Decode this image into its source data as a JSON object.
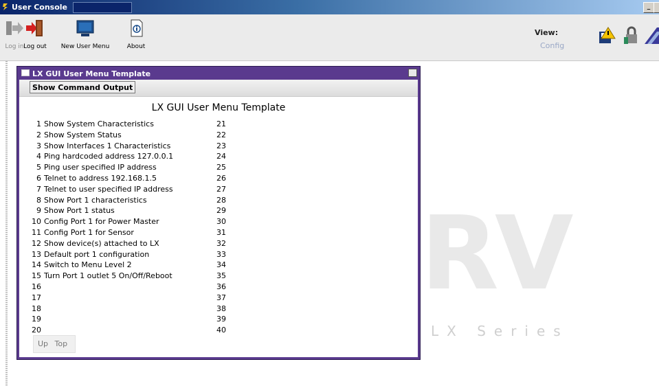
{
  "window": {
    "title": "User Console"
  },
  "toolbar": {
    "items": [
      {
        "label": "Log in",
        "icon": "login-arrow-icon",
        "enabled": false
      },
      {
        "label": "Log out",
        "icon": "logout-door-icon",
        "enabled": true
      },
      {
        "label": "New User Menu",
        "icon": "monitor-menu-icon",
        "enabled": true
      },
      {
        "label": "About",
        "icon": "info-document-icon",
        "enabled": true
      }
    ],
    "view_label": "View:",
    "view_value": "Config"
  },
  "watermark": {
    "brand": "RV",
    "series": "LX Series"
  },
  "inner_window": {
    "title": "LX GUI User Menu Template",
    "command_button": "Show Command Output",
    "heading": "LX GUI User Menu Template",
    "left_column": [
      {
        "num": "1",
        "text": "Show System Characteristics"
      },
      {
        "num": "2",
        "text": "Show System Status"
      },
      {
        "num": "3",
        "text": "Show Interfaces 1 Characteristics"
      },
      {
        "num": "4",
        "text": "Ping hardcoded address 127.0.0.1"
      },
      {
        "num": "5",
        "text": "Ping user specified IP address"
      },
      {
        "num": "6",
        "text": "Telnet to address 192.168.1.5"
      },
      {
        "num": "7",
        "text": "Telnet to user specified IP address"
      },
      {
        "num": "8",
        "text": "Show Port 1 characteristics"
      },
      {
        "num": "9",
        "text": "Show Port 1 status"
      },
      {
        "num": "10",
        "text": "Config Port 1 for Power Master"
      },
      {
        "num": "11",
        "text": "Config Port 1 for Sensor"
      },
      {
        "num": "12",
        "text": "Show device(s) attached to LX"
      },
      {
        "num": "13",
        "text": "Default port 1 configuration"
      },
      {
        "num": "14",
        "text": "Switch to Menu Level 2"
      },
      {
        "num": "15",
        "text": "Turn Port 1 outlet 5 On/Off/Reboot"
      },
      {
        "num": "16",
        "text": ""
      },
      {
        "num": "17",
        "text": ""
      },
      {
        "num": "18",
        "text": ""
      },
      {
        "num": "19",
        "text": ""
      },
      {
        "num": "20",
        "text": ""
      }
    ],
    "right_column": [
      {
        "num": "21",
        "text": ""
      },
      {
        "num": "22",
        "text": ""
      },
      {
        "num": "23",
        "text": ""
      },
      {
        "num": "24",
        "text": ""
      },
      {
        "num": "25",
        "text": ""
      },
      {
        "num": "26",
        "text": ""
      },
      {
        "num": "27",
        "text": ""
      },
      {
        "num": "28",
        "text": ""
      },
      {
        "num": "29",
        "text": ""
      },
      {
        "num": "30",
        "text": ""
      },
      {
        "num": "31",
        "text": ""
      },
      {
        "num": "32",
        "text": ""
      },
      {
        "num": "33",
        "text": ""
      },
      {
        "num": "34",
        "text": ""
      },
      {
        "num": "35",
        "text": ""
      },
      {
        "num": "36",
        "text": ""
      },
      {
        "num": "37",
        "text": ""
      },
      {
        "num": "38",
        "text": ""
      },
      {
        "num": "39",
        "text": ""
      },
      {
        "num": "40",
        "text": ""
      }
    ],
    "nav": {
      "up": "Up",
      "top": "Top"
    }
  }
}
